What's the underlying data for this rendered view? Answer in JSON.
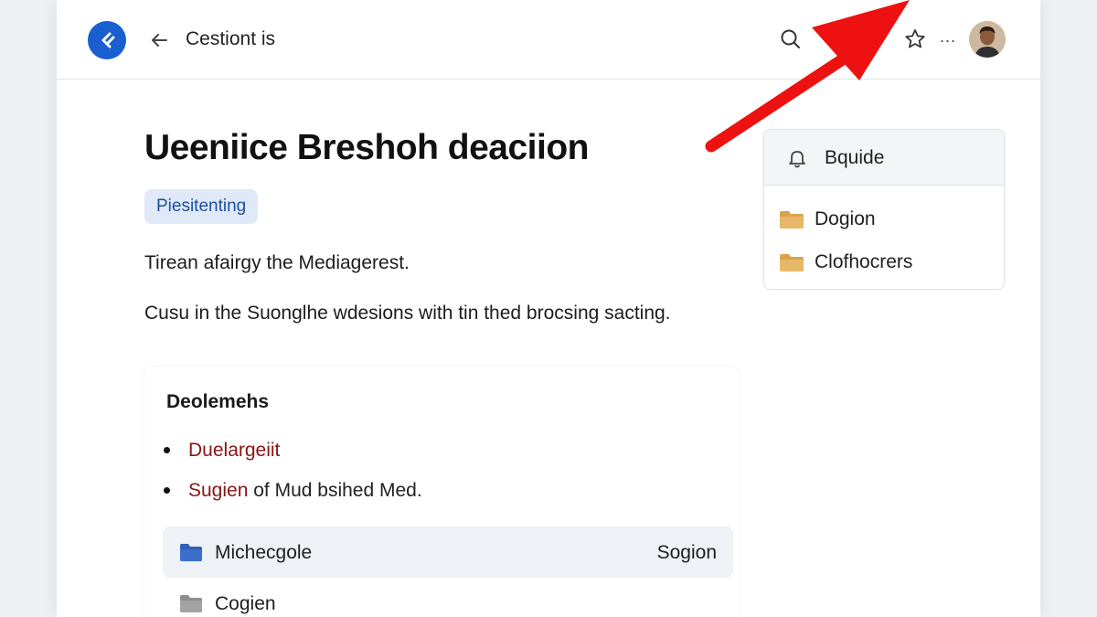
{
  "header": {
    "title": "Cestiont is",
    "icons": [
      "app-logo-icon",
      "back-arrow-icon",
      "search-icon",
      "star-icon",
      "more-icon",
      "avatar"
    ],
    "more_label": "..."
  },
  "document": {
    "title": "Ueeniice Breshoh deaciion",
    "tag": "Piesitenting",
    "paragraph1": "Tirean afairgy the Mediagerest.",
    "paragraph2": "Cusu in the Suonglhe wdesions with tin thed brocsing sacting."
  },
  "card": {
    "title": "Deolemehs",
    "bullets": [
      {
        "link": "Duelargeiit",
        "rest": ""
      },
      {
        "link": "Sugien",
        "rest": " of Mud bsihed Med."
      }
    ],
    "files": [
      {
        "name": "Michecgole",
        "meta": "Sogion",
        "selected": true,
        "folder_color": "#2f5fb8"
      },
      {
        "name": "Cogien",
        "meta": "",
        "selected": false,
        "folder_color": "#8e8e8e"
      }
    ]
  },
  "side_panel": {
    "header": "Bquide",
    "items": [
      {
        "name": "Dogion",
        "folder_color": "#e0b060"
      },
      {
        "name": "Clofhocrers",
        "folder_color": "#e0b060"
      }
    ]
  },
  "colors": {
    "accent": "#1a5fd0",
    "annotation_arrow": "#ee1111",
    "link_red": "#8a1414",
    "tag_bg": "#dfe9f8"
  }
}
